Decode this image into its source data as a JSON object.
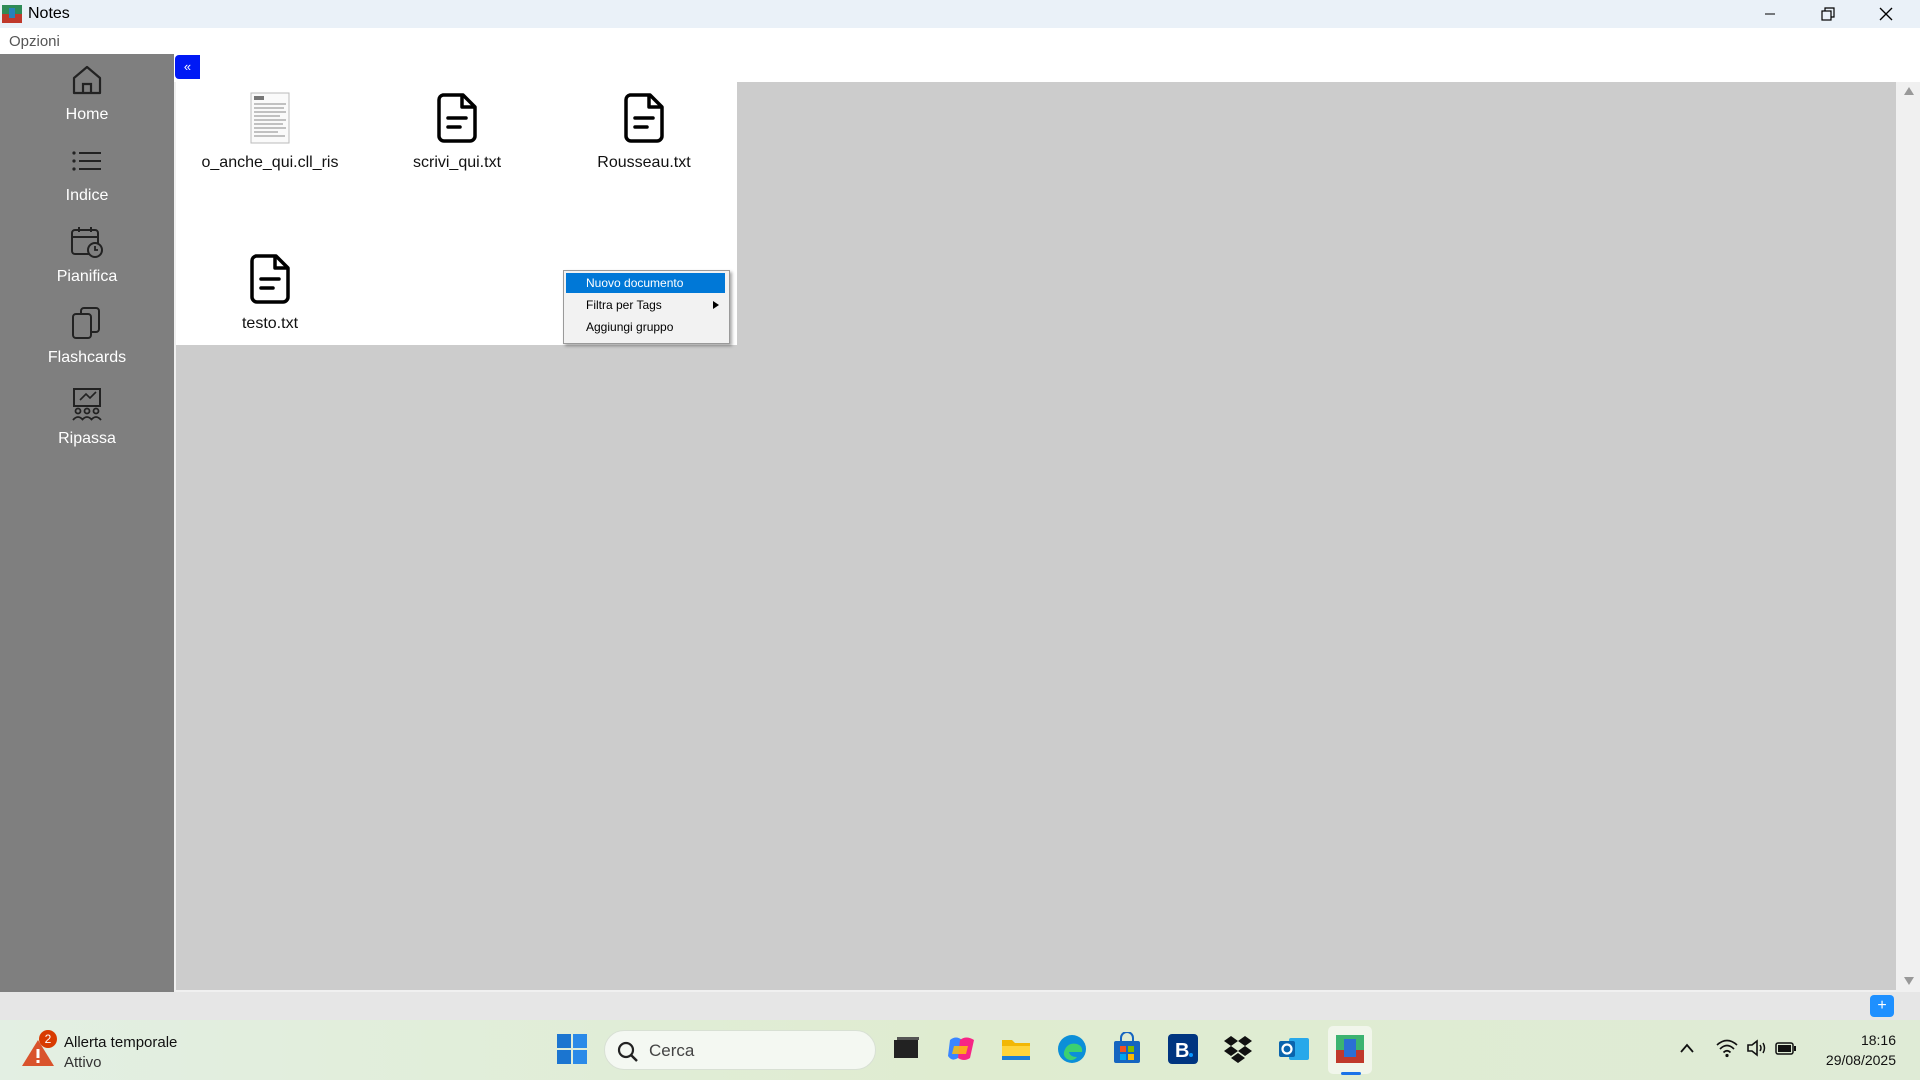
{
  "window": {
    "title": "Notes"
  },
  "menu": {
    "options_label": "Opzioni"
  },
  "sidebar": {
    "items": [
      {
        "label": "Home",
        "icon": "home-icon"
      },
      {
        "label": "Indice",
        "icon": "list-icon"
      },
      {
        "label": "Pianifica",
        "icon": "calendar-clock-icon"
      },
      {
        "label": "Flashcards",
        "icon": "cards-icon"
      },
      {
        "label": "Ripassa",
        "icon": "presentation-icon"
      }
    ]
  },
  "toolbar": {
    "collapse_label": "«"
  },
  "files": [
    {
      "name": "o_anche_qui.cll_ris",
      "icon": "document-thumbnail-icon"
    },
    {
      "name": "scrivi_qui.txt",
      "icon": "text-file-icon"
    },
    {
      "name": "Rousseau.txt",
      "icon": "text-file-icon"
    },
    {
      "name": "testo.txt",
      "icon": "text-file-icon"
    }
  ],
  "context_menu": {
    "items": [
      {
        "label": "Nuovo documento",
        "selected": true
      },
      {
        "label": "Filtra per Tags",
        "has_submenu": true
      },
      {
        "label": "Aggiungi gruppo"
      }
    ]
  },
  "bottom": {
    "add_label": "+"
  },
  "taskbar": {
    "weather_badge": "2",
    "weather_title": "Allerta temporale",
    "weather_status": "Attivo",
    "search_placeholder": "Cerca",
    "time": "18:16",
    "date": "29/08/2025"
  },
  "colors": {
    "sidebar": "#7f7f7f",
    "accent_blue": "#0019f5",
    "menu_highlight": "#0078d7",
    "content_bg": "#cccccc"
  }
}
